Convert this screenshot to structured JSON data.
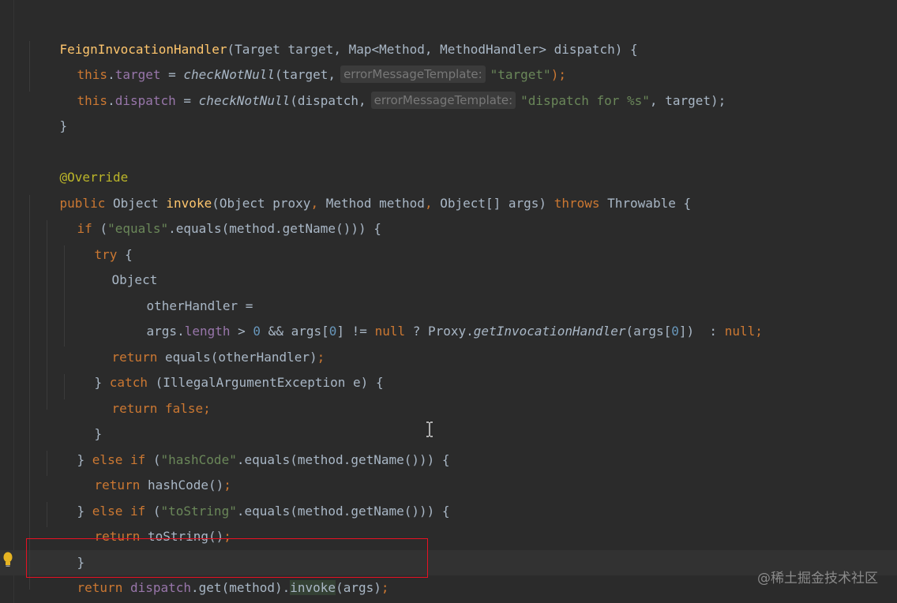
{
  "editor": {
    "lines": [
      [
        "FeignInvocationHandler",
        "(Target target, Map<Method, MethodHandler> dispatch) {"
      ],
      [
        "this",
        ".",
        "target",
        " = ",
        "checkNotNull",
        "(target,",
        "errorMessageTemplate:",
        "\"target\"",
        ");"
      ],
      [
        "this",
        ".",
        "dispatch",
        " = ",
        "checkNotNull",
        "(dispatch,",
        "errorMessageTemplate:",
        "\"dispatch for %s\"",
        ", target);"
      ],
      [
        "}"
      ],
      [
        "@Override"
      ],
      [
        "public ",
        "Object ",
        "invoke",
        "(Object proxy",
        ", ",
        "Method method",
        ", ",
        "Object[] args) ",
        "throws ",
        "Throwable {"
      ],
      [
        "if ",
        "(",
        "\"equals\"",
        ".equals(method.getName())) {"
      ],
      [
        "try ",
        "{"
      ],
      [
        "Object"
      ],
      [
        "otherHandler ="
      ],
      [
        "args.",
        "length",
        " > ",
        "0",
        " && args[",
        "0",
        "] != ",
        "null",
        " ? Proxy.",
        "getInvocationHandler",
        "(args[",
        "0",
        "]) ",
        " : ",
        "null",
        ";"
      ],
      [
        "return ",
        "equals(otherHandler)",
        ";"
      ],
      [
        "} ",
        "catch ",
        "(IllegalArgumentException e) {"
      ],
      [
        "return ",
        "false",
        ";"
      ],
      [
        "}"
      ],
      [
        "} ",
        "else if ",
        "(",
        "\"hashCode\"",
        ".equals(method.getName())) {"
      ],
      [
        "return ",
        "hashCode()",
        ";"
      ],
      [
        "} ",
        "else if ",
        "(",
        "\"toString\"",
        ".equals(method.getName())) {"
      ],
      [
        "return ",
        "toString()",
        ";"
      ],
      [
        "}"
      ],
      [
        "return ",
        "dispatch",
        ".get(method).",
        "invoke",
        "(args)",
        ";"
      ],
      [
        "}"
      ]
    ]
  },
  "watermark": "@稀土掘金技术社区",
  "colors": {
    "background": "#2b2b2b",
    "keyword": "#cc7832",
    "method_declaration": "#ffc66d",
    "string": "#6a8759",
    "number": "#6897bb",
    "field": "#9876aa",
    "annotation": "#bbb529",
    "default_text": "#a9b7c6",
    "highlight_box": "#e81123"
  },
  "icons": {
    "bulb": "lightbulb-icon",
    "cursor": "text-cursor-icon"
  }
}
